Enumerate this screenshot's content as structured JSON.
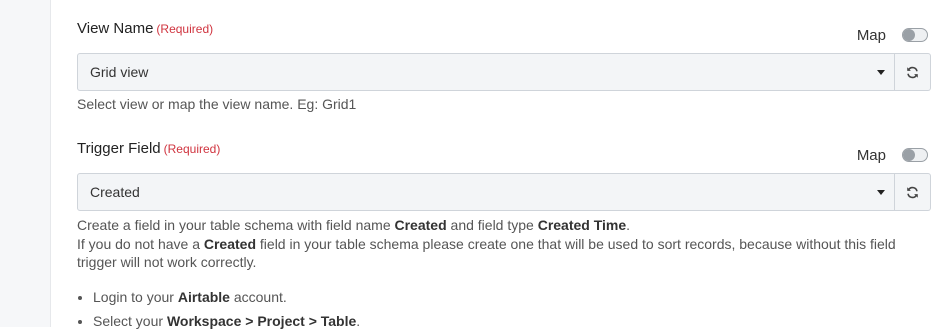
{
  "view_name": {
    "label": "View Name",
    "required": "(Required)",
    "map_label": "Map",
    "map_enabled": false,
    "selected": "Grid view",
    "help": "Select view or map the view name. Eg: Grid1"
  },
  "trigger_field": {
    "label": "Trigger Field",
    "required": "(Required)",
    "map_label": "Map",
    "map_enabled": false,
    "selected": "Created",
    "help_line1": {
      "t1": "Create a field in your table schema with field name ",
      "b1": "Created",
      "t2": " and field type ",
      "b2": "Created Time",
      "t3": "."
    },
    "help_line2": {
      "t1": "If you do not have a ",
      "b1": "Created",
      "t2": " field in your table schema please create one that will be used to sort records, because without this field trigger will not work correctly."
    }
  },
  "steps": [
    {
      "t1": "Login to your ",
      "b1": "Airtable",
      "t2": " account."
    },
    {
      "t1": "Select your ",
      "b1": "Workspace > Project > Table",
      "t2": "."
    }
  ],
  "icons": {
    "refresh": "refresh-icon",
    "caret": "chevron-down-icon"
  },
  "colors": {
    "required": "#d0343f",
    "select_bg": "#f3f5f7",
    "border": "#cfd4da"
  }
}
